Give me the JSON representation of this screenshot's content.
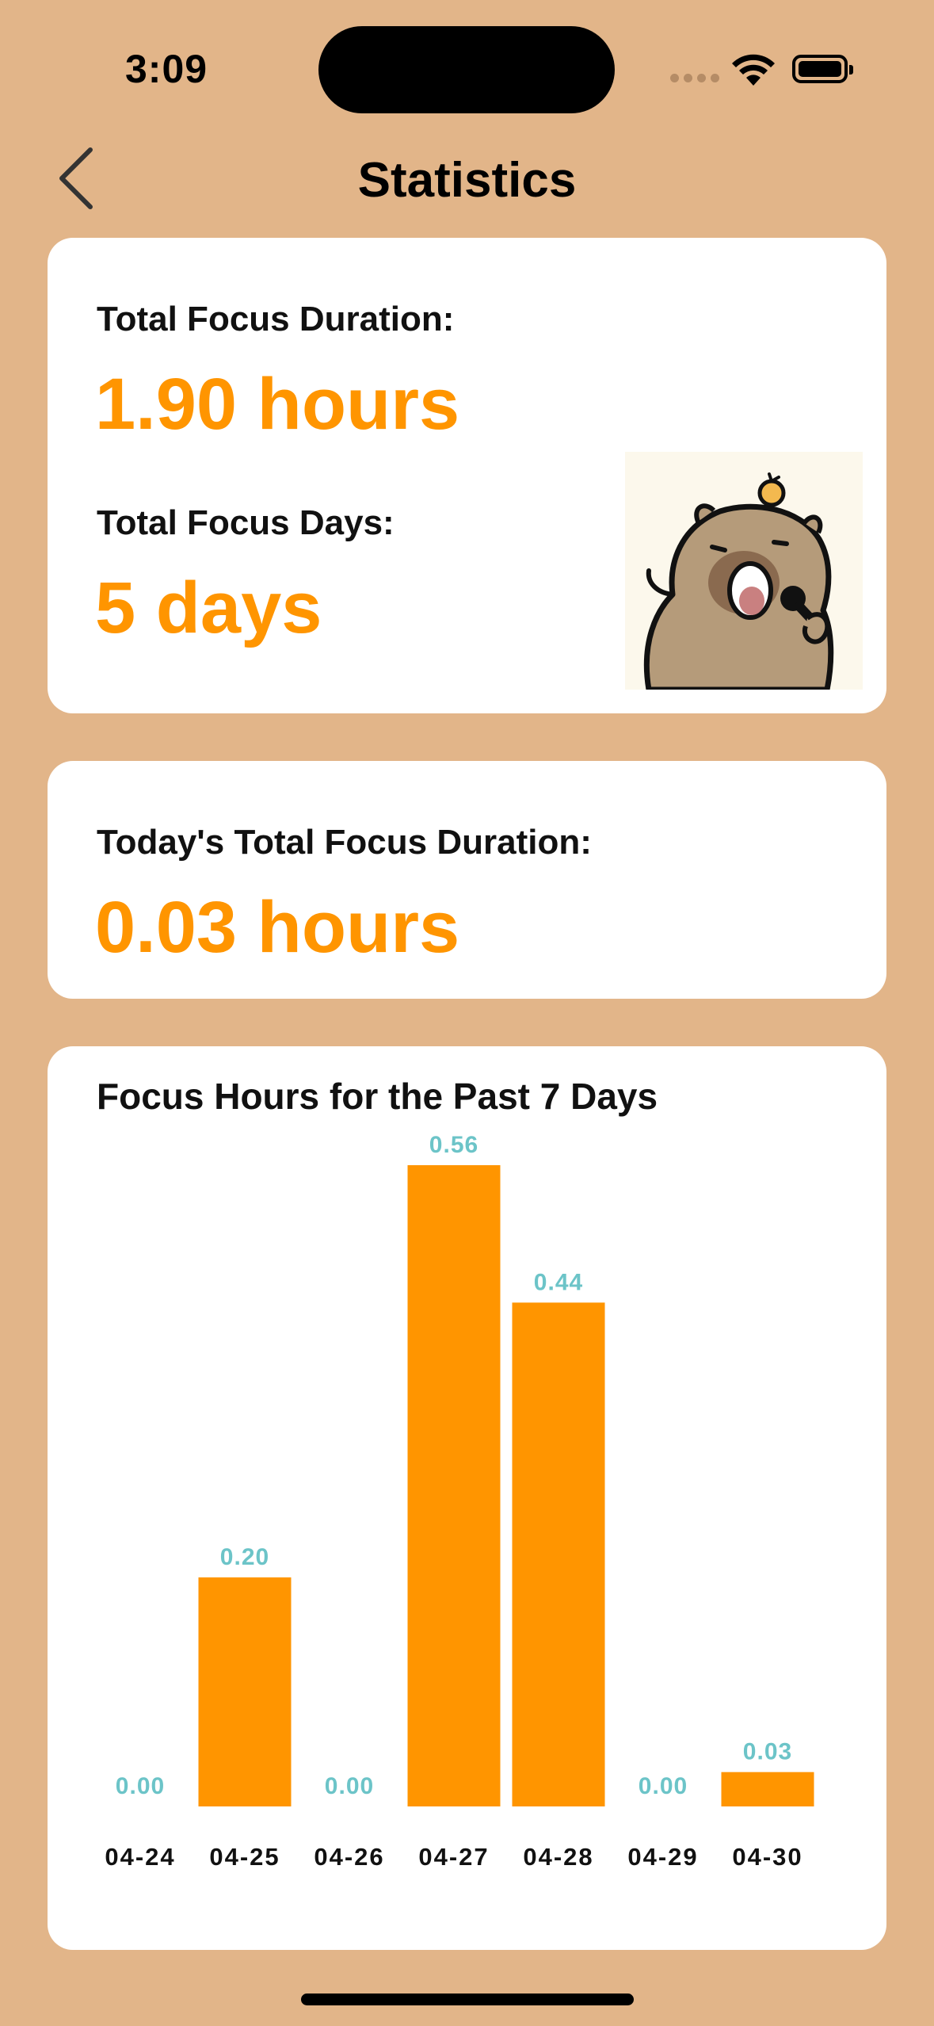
{
  "status_bar": {
    "time": "3:09"
  },
  "nav": {
    "title": "Statistics",
    "back_icon": "chevron-left-icon"
  },
  "summary": {
    "total_duration_label": "Total Focus Duration:",
    "total_duration_value": "1.90 hours",
    "total_days_label": "Total Focus Days:",
    "total_days_value": "5 days"
  },
  "today": {
    "label": "Today's Total Focus Duration:",
    "value": "0.03 hours"
  },
  "colors": {
    "accent": "#FF9500",
    "value_label": "#6CC4C8",
    "background": "#E2B589"
  },
  "chart_data": {
    "type": "bar",
    "title": "Focus Hours for the Past 7 Days",
    "categories": [
      "04-24",
      "04-25",
      "04-26",
      "04-27",
      "04-28",
      "04-29",
      "04-30"
    ],
    "values": [
      0.0,
      0.2,
      0.0,
      0.56,
      0.44,
      0.0,
      0.03
    ],
    "value_labels": [
      "0.00",
      "0.20",
      "0.00",
      "0.56",
      "0.44",
      "0.00",
      "0.03"
    ],
    "ylim": [
      0,
      0.56
    ]
  }
}
